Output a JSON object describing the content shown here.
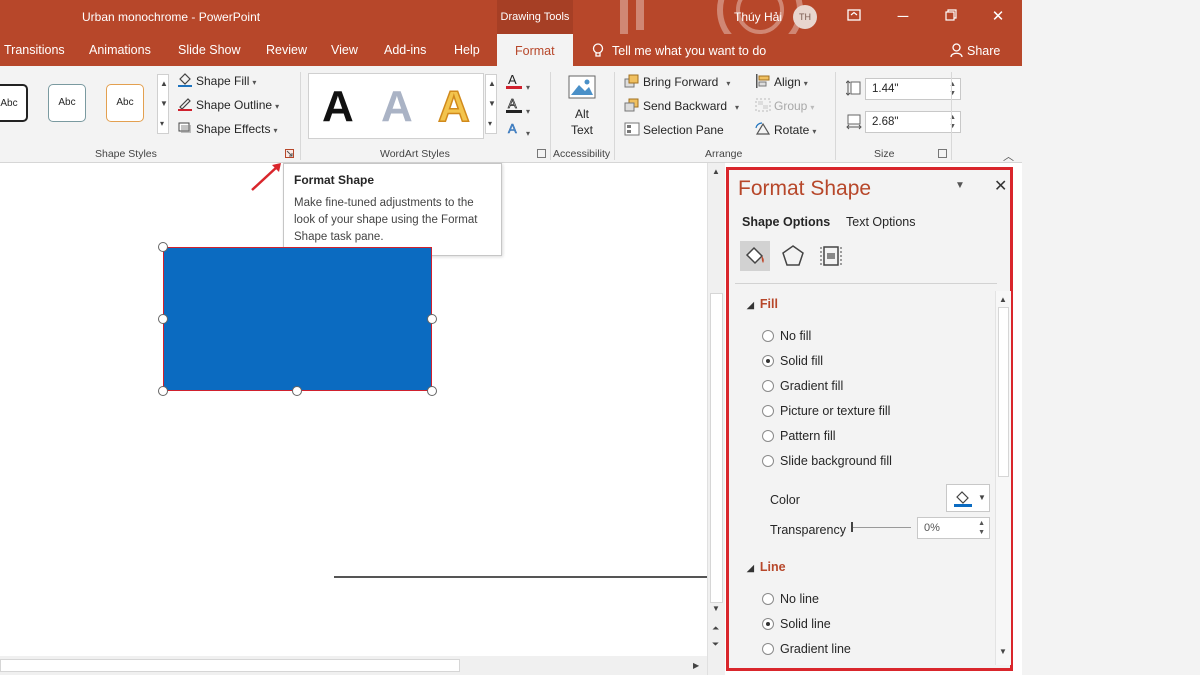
{
  "window": {
    "title": "Urban monochrome  -  PowerPoint",
    "context_tab": "Drawing Tools",
    "user": "Thúy Hải",
    "avatar_initials": "TH",
    "accent": "#b7472a"
  },
  "tabs": [
    "Transitions",
    "Animations",
    "Slide Show",
    "Review",
    "View",
    "Add-ins",
    "Help",
    "Format"
  ],
  "active_tab": "Format",
  "tell_me": "Tell me what you want to do",
  "share": "Share",
  "ribbon": {
    "shape_styles": {
      "label": "Shape Styles",
      "gallery": [
        "Abc",
        "Abc",
        "Abc"
      ],
      "shape_fill": "Shape Fill",
      "shape_outline": "Shape Outline",
      "shape_effects": "Shape Effects"
    },
    "wordart": {
      "label": "WordArt Styles",
      "samples": [
        "A",
        "A",
        "A"
      ]
    },
    "accessibility": {
      "label": "Accessibility",
      "alt_text_line1": "Alt",
      "alt_text_line2": "Text"
    },
    "arrange": {
      "label": "Arrange",
      "bring_forward": "Bring Forward",
      "send_backward": "Send Backward",
      "selection_pane": "Selection Pane",
      "align": "Align",
      "group": "Group",
      "rotate": "Rotate"
    },
    "size": {
      "label": "Size",
      "height": "1.44\"",
      "width": "2.68\""
    }
  },
  "tooltip": {
    "title": "Format Shape",
    "body": "Make fine-tuned adjustments to the look of your shape using the Format Shape task pane."
  },
  "slide": {
    "shape_fill": "#0b6bc1",
    "shape_outline": "#d0212e"
  },
  "pane": {
    "title": "Format Shape",
    "tabs": [
      "Shape Options",
      "Text Options"
    ],
    "fill": {
      "heading": "Fill",
      "options": [
        "No fill",
        "Solid fill",
        "Gradient fill",
        "Picture or texture fill",
        "Pattern fill",
        "Slide background fill"
      ],
      "selected": "Solid fill",
      "color_label": "Color",
      "transparency_label": "Transparency",
      "transparency_value": "0%"
    },
    "line": {
      "heading": "Line",
      "options": [
        "No line",
        "Solid line",
        "Gradient line"
      ],
      "selected": "Solid line"
    }
  }
}
